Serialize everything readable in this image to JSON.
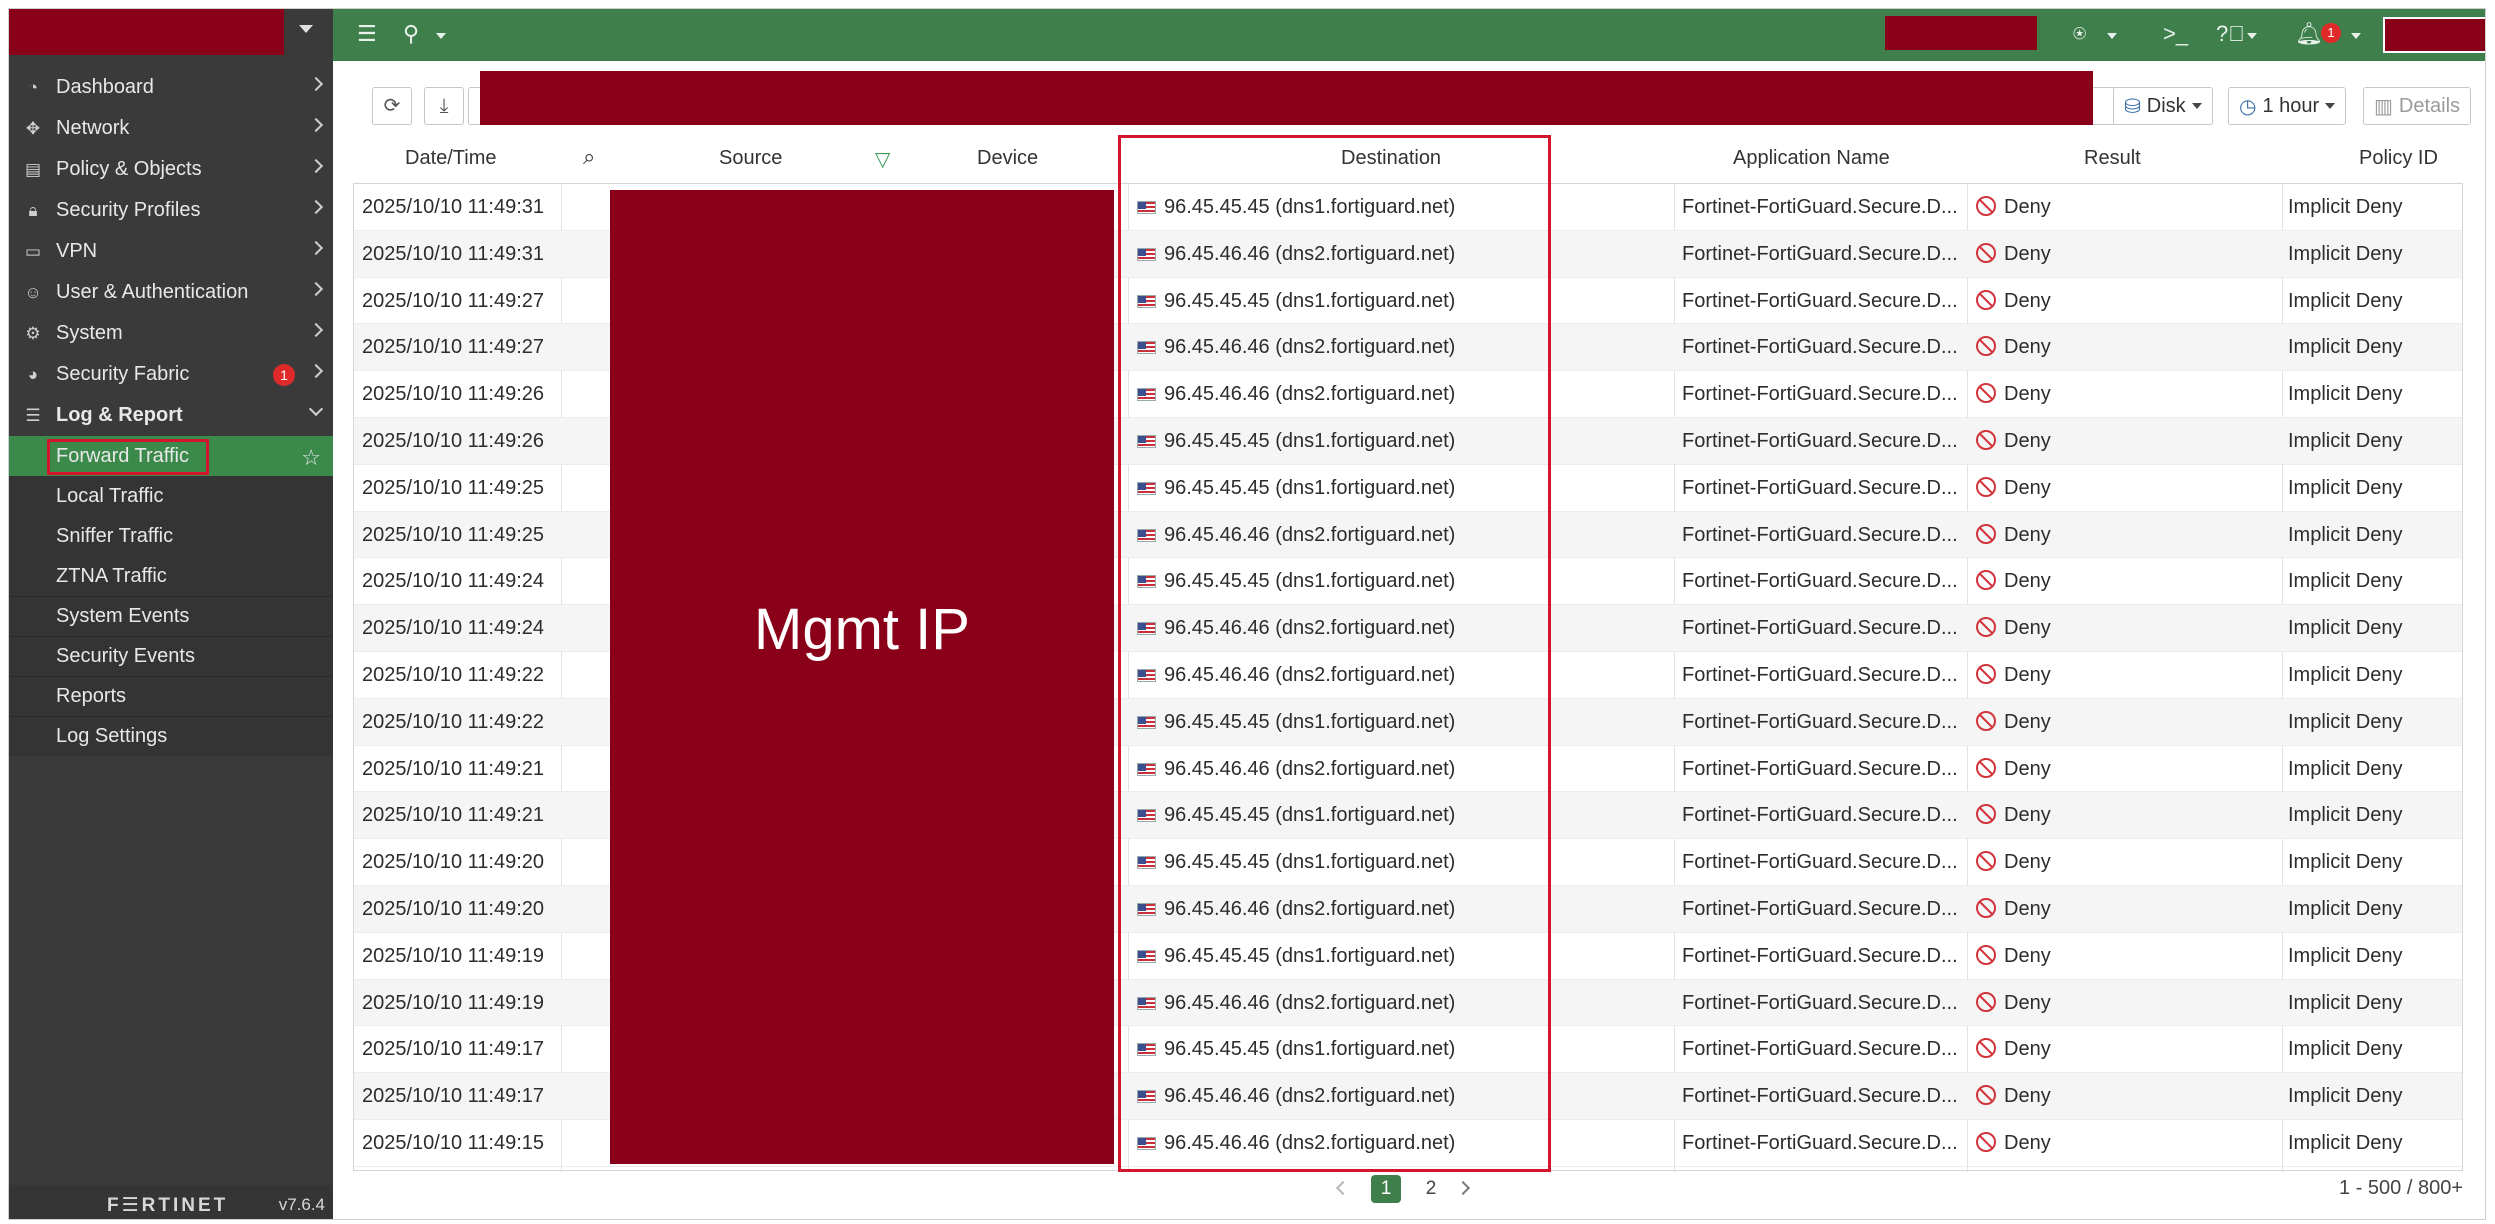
{
  "sidebar": {
    "items": [
      {
        "label": "Dashboard",
        "icon": "dashboard-icon"
      },
      {
        "label": "Network",
        "icon": "network-icon"
      },
      {
        "label": "Policy & Objects",
        "icon": "policy-icon"
      },
      {
        "label": "Security Profiles",
        "icon": "lock-icon"
      },
      {
        "label": "VPN",
        "icon": "laptop-icon"
      },
      {
        "label": "User & Authentication",
        "icon": "user-icon"
      },
      {
        "label": "System",
        "icon": "gear-icon"
      },
      {
        "label": "Security Fabric",
        "icon": "fabric-icon",
        "badge": "1"
      },
      {
        "label": "Log & Report",
        "icon": "chart-icon"
      }
    ],
    "log_sub": [
      "Forward Traffic",
      "Local Traffic",
      "Sniffer Traffic",
      "ZTNA Traffic",
      "System Events",
      "Security Events",
      "Reports",
      "Log Settings"
    ],
    "logo": "F☰RTINET",
    "version": "v7.6.4"
  },
  "topbar": {
    "notification_count": "1"
  },
  "toolbar": {
    "disk_label": "Disk",
    "time_label": "1 hour",
    "details_label": "Details"
  },
  "table": {
    "columns": [
      "Date/Time",
      "Source",
      "Device",
      "Destination",
      "Application Name",
      "Result",
      "Policy ID"
    ],
    "source_overlay": "Mgmt IP",
    "rows": [
      {
        "time": "2025/10/10 11:49:31",
        "dest": "96.45.45.45 (dns1.fortiguard.net)"
      },
      {
        "time": "2025/10/10 11:49:31",
        "dest": "96.45.46.46 (dns2.fortiguard.net)"
      },
      {
        "time": "2025/10/10 11:49:27",
        "dest": "96.45.45.45 (dns1.fortiguard.net)"
      },
      {
        "time": "2025/10/10 11:49:27",
        "dest": "96.45.46.46 (dns2.fortiguard.net)"
      },
      {
        "time": "2025/10/10 11:49:26",
        "dest": "96.45.46.46 (dns2.fortiguard.net)"
      },
      {
        "time": "2025/10/10 11:49:26",
        "dest": "96.45.45.45 (dns1.fortiguard.net)"
      },
      {
        "time": "2025/10/10 11:49:25",
        "dest": "96.45.45.45 (dns1.fortiguard.net)"
      },
      {
        "time": "2025/10/10 11:49:25",
        "dest": "96.45.46.46 (dns2.fortiguard.net)"
      },
      {
        "time": "2025/10/10 11:49:24",
        "dest": "96.45.45.45 (dns1.fortiguard.net)"
      },
      {
        "time": "2025/10/10 11:49:24",
        "dest": "96.45.46.46 (dns2.fortiguard.net)"
      },
      {
        "time": "2025/10/10 11:49:22",
        "dest": "96.45.46.46 (dns2.fortiguard.net)"
      },
      {
        "time": "2025/10/10 11:49:22",
        "dest": "96.45.45.45 (dns1.fortiguard.net)"
      },
      {
        "time": "2025/10/10 11:49:21",
        "dest": "96.45.46.46 (dns2.fortiguard.net)"
      },
      {
        "time": "2025/10/10 11:49:21",
        "dest": "96.45.45.45 (dns1.fortiguard.net)"
      },
      {
        "time": "2025/10/10 11:49:20",
        "dest": "96.45.45.45 (dns1.fortiguard.net)"
      },
      {
        "time": "2025/10/10 11:49:20",
        "dest": "96.45.46.46 (dns2.fortiguard.net)"
      },
      {
        "time": "2025/10/10 11:49:19",
        "dest": "96.45.45.45 (dns1.fortiguard.net)"
      },
      {
        "time": "2025/10/10 11:49:19",
        "dest": "96.45.46.46 (dns2.fortiguard.net)"
      },
      {
        "time": "2025/10/10 11:49:17",
        "dest": "96.45.45.45 (dns1.fortiguard.net)"
      },
      {
        "time": "2025/10/10 11:49:17",
        "dest": "96.45.46.46 (dns2.fortiguard.net)"
      },
      {
        "time": "2025/10/10 11:49:15",
        "dest": "96.45.46.46 (dns2.fortiguard.net)"
      }
    ],
    "app_name": "Fortinet-FortiGuard.Secure.D...",
    "result": "Deny",
    "policy": "Implicit Deny"
  },
  "pager": {
    "pages": [
      "1",
      "2"
    ],
    "count": "1 - 500 / 800+"
  }
}
